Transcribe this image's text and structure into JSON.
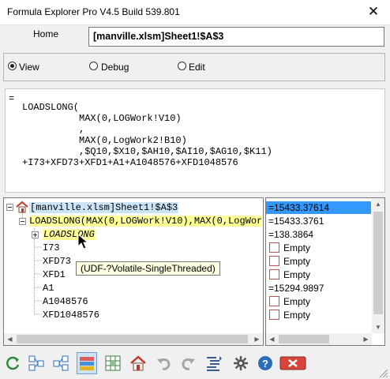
{
  "window": {
    "title": "Formula Explorer Pro V4.5 Build 539.801",
    "close_glyph": "✕"
  },
  "address": {
    "home_label": "Home",
    "cell_ref": "[manville.xlsm]Sheet1!$A$3"
  },
  "mode": {
    "options": [
      "View",
      "Debug",
      "Edit"
    ],
    "selected": "View"
  },
  "formula_lines": [
    "=",
    "LOADSLONG(",
    "          MAX(0,LOGWork!V10)",
    "          ,",
    "          MAX(0,LogWork2!B10)",
    "          ,$Q10,$X10,$AH10,$AI10,$AG10,$K11)",
    "+I73+XFD73+XFD1+A1+A1048576+XFD1048576"
  ],
  "tree": {
    "root": "[manville.xlsm]Sheet1!$A$3",
    "child": "LOADSLONG(MAX(0,LOGWork!V10),MAX(0,LogWork",
    "function_node": "LOADSLONG",
    "refs": [
      "I73",
      "XFD73",
      "XFD1",
      "A1",
      "A1048576",
      "XFD1048576"
    ],
    "tooltip": "(UDF-?Volatile-SingleThreaded)"
  },
  "values": [
    {
      "text": "=15433.37614",
      "checkbox": false,
      "selected": true
    },
    {
      "text": "=15433.3761",
      "checkbox": false,
      "selected": false
    },
    {
      "text": "=138.3864",
      "checkbox": false,
      "selected": false
    },
    {
      "text": "Empty",
      "checkbox": true,
      "selected": false
    },
    {
      "text": "Empty",
      "checkbox": true,
      "selected": false
    },
    {
      "text": "Empty",
      "checkbox": true,
      "selected": false
    },
    {
      "text": "=15294.9897",
      "checkbox": false,
      "selected": false
    },
    {
      "text": "Empty",
      "checkbox": true,
      "selected": false
    },
    {
      "text": "Empty",
      "checkbox": true,
      "selected": false
    }
  ],
  "toolbar_icons": [
    "refresh-icon",
    "trace-precedents-icon",
    "trace-dependents-icon",
    "color-palette-icon",
    "grid-select-icon",
    "home-icon",
    "undo-icon",
    "redo-icon",
    "indent-format-icon",
    "settings-gear-icon",
    "help-icon",
    "close-red-icon"
  ],
  "colors": {
    "selection": "#cce4f7",
    "highlight": "#ffff99",
    "selected_value": "#3399ff",
    "checkbox_border": "#c0504d"
  }
}
